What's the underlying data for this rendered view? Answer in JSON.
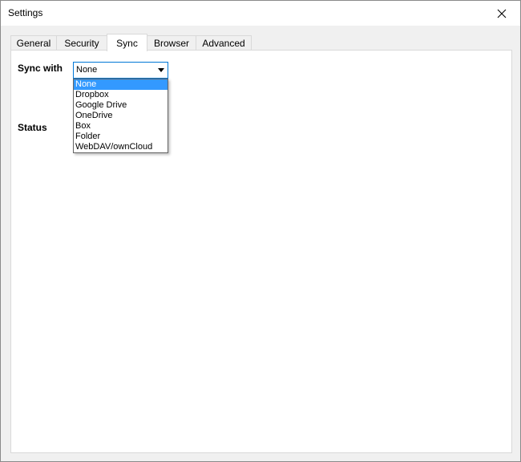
{
  "window": {
    "title": "Settings",
    "close_icon": "close-icon"
  },
  "tabs": [
    {
      "label": "General",
      "active": false
    },
    {
      "label": "Security",
      "active": false
    },
    {
      "label": "Sync",
      "active": true
    },
    {
      "label": "Browser",
      "active": false
    },
    {
      "label": "Advanced",
      "active": false
    }
  ],
  "sync": {
    "sync_with_label": "Sync with",
    "status_label": "Status",
    "combo": {
      "selected": "None",
      "options": [
        "None",
        "Dropbox",
        "Google Drive",
        "OneDrive",
        "Box",
        "Folder",
        "WebDAV/ownCloud"
      ],
      "highlighted_index": 0
    }
  },
  "colors": {
    "accent": "#0078d7",
    "selection": "#3399ff"
  }
}
